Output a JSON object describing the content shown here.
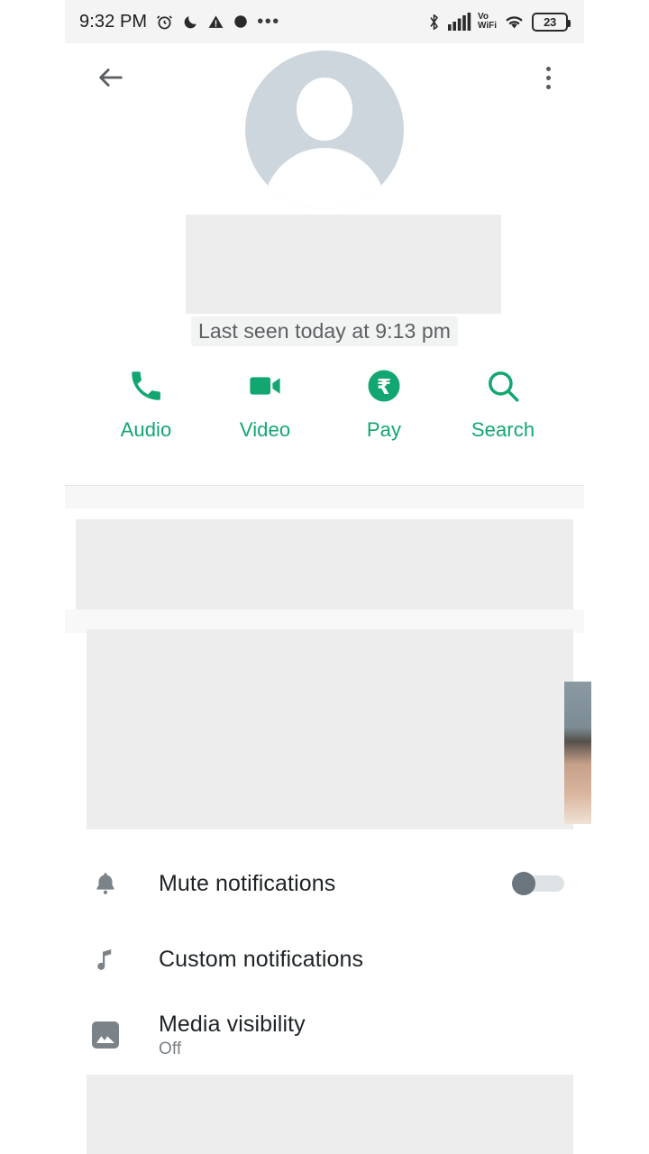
{
  "status_bar": {
    "time": "9:32 PM",
    "icons_left": [
      "alarm-icon",
      "do-not-disturb-icon",
      "warning-icon",
      "record-icon",
      "more-dots-icon"
    ],
    "icons_right": [
      "bluetooth-icon",
      "cellular-signal-icon",
      "vowifi-icon",
      "wifi-icon"
    ],
    "vowifi_top": "Vo",
    "vowifi_bottom": "WiFi",
    "battery_percent": "23"
  },
  "appbar": {
    "back_label": "Back",
    "overflow_label": "More options"
  },
  "profile": {
    "avatar": "default-person-avatar",
    "name_redacted": true,
    "last_seen": "Last seen today at 9:13 pm"
  },
  "actions": [
    {
      "id": "audio",
      "label": "Audio",
      "icon": "phone-icon"
    },
    {
      "id": "video",
      "label": "Video",
      "icon": "video-camera-icon"
    },
    {
      "id": "pay",
      "label": "Pay",
      "icon": "rupee-pay-icon"
    },
    {
      "id": "search",
      "label": "Search",
      "icon": "search-icon"
    }
  ],
  "redacted_sections": {
    "name_block": "",
    "section_one": "",
    "section_two": "",
    "bottom_block": ""
  },
  "settings": [
    {
      "id": "mute-notifications",
      "title": "Mute notifications",
      "subtitle": "",
      "icon": "bell-icon",
      "control": "toggle",
      "toggle_on": false
    },
    {
      "id": "custom-notifications",
      "title": "Custom notifications",
      "subtitle": "",
      "icon": "music-note-icon",
      "control": "none"
    },
    {
      "id": "media-visibility",
      "title": "Media visibility",
      "subtitle": "Off",
      "icon": "image-icon",
      "control": "none"
    }
  ],
  "colors": {
    "accent_green": "#12a670",
    "status_bar_bg": "#f4f4f4",
    "redact_gray": "#ededed",
    "avatar_gray": "#ced6dd",
    "toggle_knob": "#6b757d",
    "text_primary": "#1f2326",
    "text_secondary": "#7b8084"
  }
}
